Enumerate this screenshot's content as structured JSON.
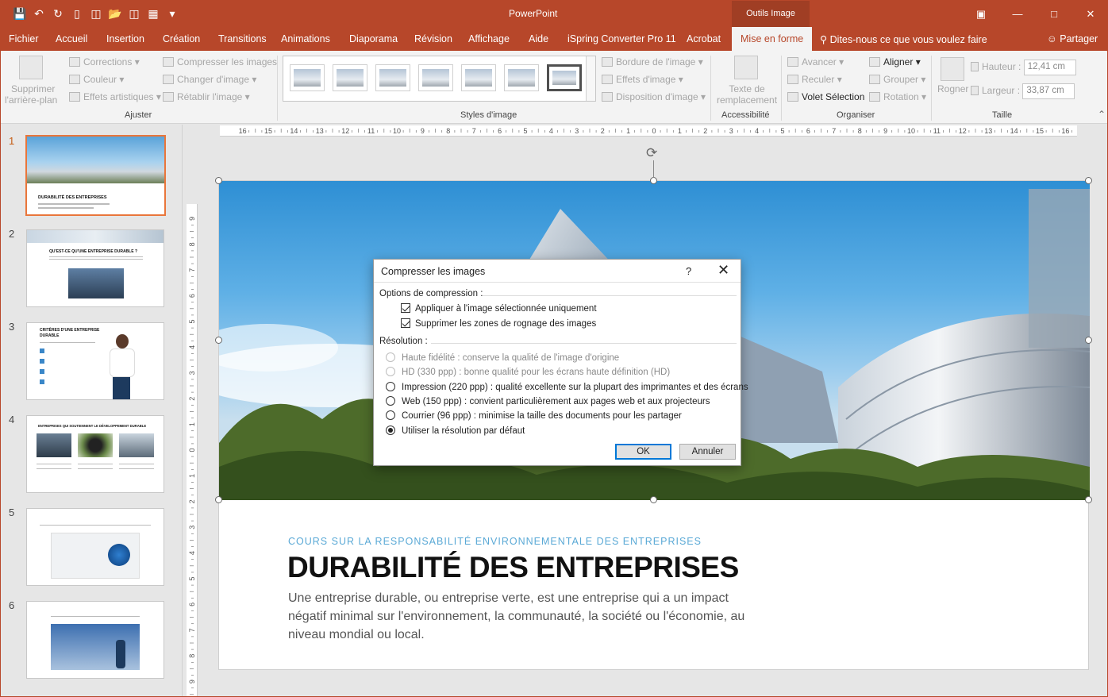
{
  "titlebar": {
    "app_title": "PowerPoint",
    "context_tab": "Outils Image",
    "qat_icons": [
      "save-icon",
      "undo-icon",
      "redo-icon",
      "present-icon",
      "new-icon",
      "open-icon",
      "layout-icon",
      "more-icon",
      "customize-icon"
    ]
  },
  "menu": {
    "tabs": [
      "Fichier",
      "Accueil",
      "Insertion",
      "Création",
      "Transitions",
      "Animations",
      "Diaporama",
      "Révision",
      "Affichage",
      "Aide",
      "iSpring Converter Pro 11",
      "Acrobat",
      "Mise en forme"
    ],
    "tell_me": "Dites-nous ce que vous voulez faire",
    "share": "Partager"
  },
  "ribbon": {
    "remove_bg": [
      "Supprimer",
      "l'arrière-plan"
    ],
    "corrections": "Corrections",
    "couleur": "Couleur",
    "effets_artistiques": "Effets artistiques",
    "compresser": "Compresser les images",
    "changer": "Changer d'image",
    "retablir": "Rétablir l'image",
    "group_ajuster": "Ajuster",
    "bordure": "Bordure de l'image",
    "effets_image": "Effets d'image",
    "disposition": "Disposition d'image",
    "group_styles": "Styles d'image",
    "texte_remplacement": [
      "Texte de",
      "remplacement"
    ],
    "group_accessibilite": "Accessibilité",
    "avancer": "Avancer",
    "reculer": "Reculer",
    "volet_selection": "Volet Sélection",
    "aligner": "Aligner",
    "grouper": "Grouper",
    "rotation": "Rotation",
    "group_organiser": "Organiser",
    "rogner": "Rogner",
    "hauteur_label": "Hauteur :",
    "hauteur_value": "12,41 cm",
    "largeur_label": "Largeur :",
    "largeur_value": "33,87 cm",
    "group_taille": "Taille"
  },
  "slides": {
    "numbers": [
      "1",
      "2",
      "3",
      "4",
      "5",
      "6"
    ],
    "thumb_titles": [
      "DURABILITÉ DES ENTREPRISES",
      "QU'EST-CE QU'UNE ENTREPRISE DURABLE ?",
      "CRITÈRES D'UNE ENTREPRISE DURABLE",
      "ENTREPRISES QUI SOUTIENNENT LE DÉVELOPPEMENT DURABLE"
    ]
  },
  "slide": {
    "subtitle": "COURS SUR LA RESPONSABILITÉ ENVIRONNEMENTALE DES ENTREPRISES",
    "title": "DURABILITÉ DES ENTREPRISES",
    "body": "Une entreprise durable, ou entreprise verte, est une entreprise qui a un impact négatif minimal sur l'environnement, la communauté, la société ou l'économie, au niveau mondial ou local."
  },
  "dialog": {
    "title": "Compresser les images",
    "help": "?",
    "compression_label": "Options de compression :",
    "opt_apply": "Appliquer à l'image sélectionnée uniquement",
    "opt_delete": "Supprimer les zones de rognage des images",
    "resolution_label": "Résolution :",
    "res_hifi": "Haute fidélité : conserve la qualité de l'image d'origine",
    "res_hd": "HD (330 ppp) : bonne qualité pour les écrans haute définition (HD)",
    "res_print": "Impression (220 ppp) : qualité excellente sur la plupart des imprimantes et des écrans",
    "res_web": "Web (150 ppp) : convient particulièrement aux pages web et aux projecteurs",
    "res_email": "Courrier (96 ppp) : minimise la taille des documents pour les partager",
    "res_default": "Utiliser la résolution par défaut",
    "ok": "OK",
    "cancel": "Annuler"
  },
  "colors": {
    "accent": "#b7472a",
    "slide_subtitle": "#5aa9d6",
    "thumb_selected": "#e9763b"
  }
}
